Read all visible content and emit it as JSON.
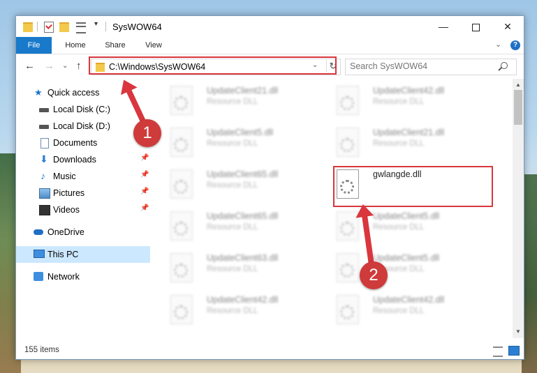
{
  "window": {
    "title": "SysWOW64",
    "controls": {
      "minimize": "—",
      "maximize": "",
      "close": "✕"
    }
  },
  "ribbon": {
    "tabs": [
      "File",
      "Home",
      "Share",
      "View"
    ],
    "help": "?",
    "collapse_chevron": "⌄"
  },
  "navigation": {
    "back": "←",
    "forward": "→",
    "recent": "⌄",
    "up": "↑",
    "address": "C:\\Windows\\SysWOW64",
    "address_dropdown": "⌄",
    "refresh": "↻",
    "search_placeholder": "Search SysWOW64"
  },
  "sidebar": {
    "items": [
      {
        "label": "Quick access",
        "icon": "star-icon",
        "pinned": false
      },
      {
        "label": "Local Disk (C:)",
        "icon": "drive-icon",
        "pinned": false
      },
      {
        "label": "Local Disk (D:)",
        "icon": "drive-icon",
        "pinned": false
      },
      {
        "label": "Documents",
        "icon": "documents-icon",
        "pinned": false
      },
      {
        "label": "Downloads",
        "icon": "download-icon",
        "pinned": true
      },
      {
        "label": "Music",
        "icon": "music-icon",
        "pinned": true
      },
      {
        "label": "Pictures",
        "icon": "pictures-icon",
        "pinned": true
      },
      {
        "label": "Videos",
        "icon": "videos-icon",
        "pinned": true
      },
      {
        "label": "OneDrive",
        "icon": "cloud-icon",
        "pinned": false
      },
      {
        "label": "This PC",
        "icon": "computer-icon",
        "pinned": false,
        "selected": true
      },
      {
        "label": "Network",
        "icon": "network-icon",
        "pinned": false
      }
    ],
    "pin_glyph": "📌"
  },
  "files": [
    {
      "name": "UpdateClient21.dll",
      "type": "Resource DLL",
      "blurred": true
    },
    {
      "name": "UpdateClient42.dll",
      "type": "Resource DLL",
      "blurred": true
    },
    {
      "name": "UpdateClient5.dll",
      "type": "Resource DLL",
      "blurred": true
    },
    {
      "name": "UpdateClient21.dll",
      "type": "Resource DLL",
      "blurred": true
    },
    {
      "name": "UpdateClient65.dll",
      "type": "Resource DLL",
      "blurred": true
    },
    {
      "name": "gwlangde.dll",
      "type": "",
      "blurred": false
    },
    {
      "name": "UpdateClient65.dll",
      "type": "Resource DLL",
      "blurred": true
    },
    {
      "name": "UpdateClient5.dll",
      "type": "Resource DLL",
      "blurred": true
    },
    {
      "name": "UpdateClient63.dll",
      "type": "Resource DLL",
      "blurred": true
    },
    {
      "name": "UpdateClient5.dll",
      "type": "Resource DLL",
      "blurred": true
    },
    {
      "name": "UpdateClient42.dll",
      "type": "Resource DLL",
      "blurred": true
    },
    {
      "name": "UpdateClient42.dll",
      "type": "Resource DLL",
      "blurred": true
    }
  ],
  "status": {
    "item_count": "155 items"
  },
  "annotations": {
    "step1": "1",
    "step2": "2",
    "highlight_color": "#d9363e"
  },
  "colors": {
    "file_tab": "#1979ca",
    "selection": "#cce8ff"
  }
}
